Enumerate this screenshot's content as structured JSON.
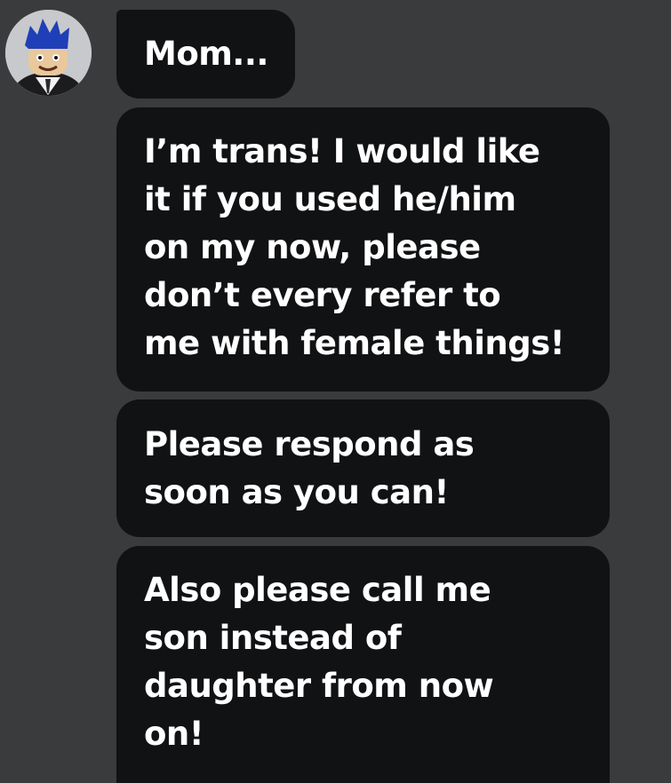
{
  "chat": {
    "avatar_icon": "roblox-avatar-icon",
    "messages": [
      {
        "lines": [
          "Mom..."
        ]
      },
      {
        "lines": [
          "I’m trans! I would like",
          "it if you used he/him",
          "on my now, please",
          "don’t every refer to",
          "me with female things!"
        ]
      },
      {
        "lines": [
          "Please respond as",
          "soon as you can!"
        ]
      },
      {
        "lines": [
          "Also please call me",
          "son instead of",
          "daughter from now",
          "on!"
        ]
      }
    ]
  },
  "colors": {
    "background": "#393b3d",
    "bubble": "#111214",
    "text": "#ffffff"
  }
}
